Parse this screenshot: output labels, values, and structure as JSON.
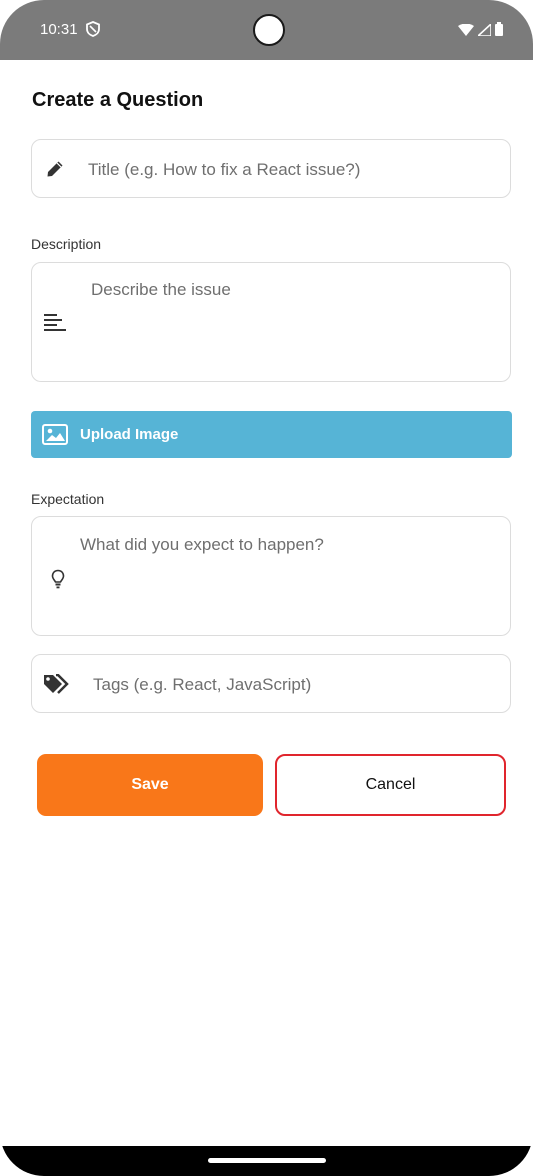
{
  "status_bar": {
    "time": "10:31"
  },
  "page": {
    "title": "Create a Question"
  },
  "form": {
    "title_field": {
      "placeholder": "Title (e.g. How to fix a React issue?)",
      "icon": "pencil-icon"
    },
    "description": {
      "label": "Description",
      "placeholder": "Describe the issue",
      "icon": "align-left-icon"
    },
    "upload": {
      "label": "Upload Image",
      "icon": "image-icon",
      "color": "#56b4d6"
    },
    "expectation": {
      "label": "Expectation",
      "placeholder": "What did you expect to happen?",
      "icon": "lightbulb-icon"
    },
    "tags_field": {
      "placeholder": "Tags (e.g. React, JavaScript)",
      "icon": "tags-icon"
    }
  },
  "actions": {
    "save_label": "Save",
    "cancel_label": "Cancel",
    "save_color": "#f97719",
    "cancel_border_color": "#e0252d"
  }
}
